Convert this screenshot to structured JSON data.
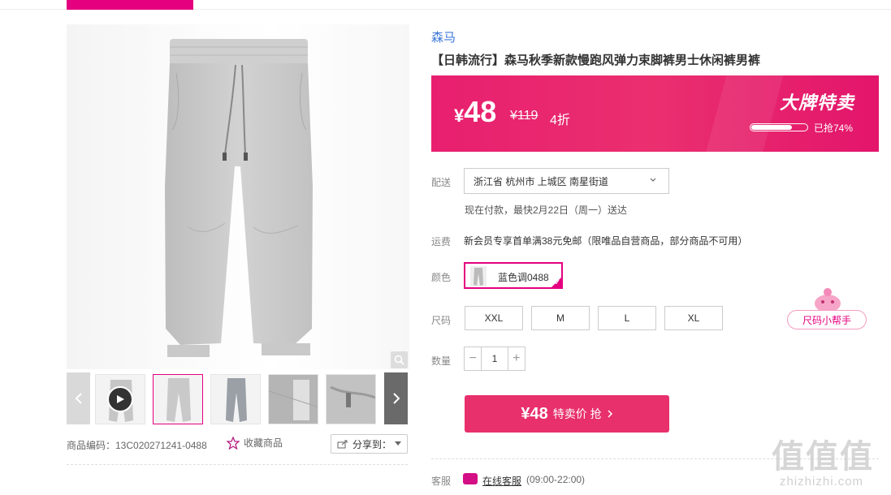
{
  "brand": "森马",
  "title": "【日韩流行】森马秋季新款慢跑风弹力束脚裤男士休闲裤男裤",
  "price": {
    "currency": "¥",
    "current": "48",
    "original": "¥119",
    "discount": "4折",
    "badge": "大牌特卖",
    "sold_text": "已抢74%",
    "sold_fraction": 0.74
  },
  "delivery": {
    "label": "配送",
    "address": "浙江省 杭州市 上城区 南星街道",
    "tip": "现在付款，最快2月22日（周一）送达"
  },
  "shipping": {
    "label": "运费",
    "text": "新会员专享首单满38元免邮（限唯品自营商品，部分商品不可用）"
  },
  "color": {
    "label": "颜色",
    "selected": "蓝色调0488"
  },
  "size": {
    "label": "尺码",
    "options": [
      "XXL",
      "M",
      "L",
      "XL"
    ],
    "helper": "尺码小帮手"
  },
  "quantity": {
    "label": "数量",
    "value": "1",
    "minus": "−",
    "plus": "+"
  },
  "buy": {
    "price": "¥48",
    "text": "特卖价 抢"
  },
  "service": {
    "label": "客服",
    "link": "在线客服",
    "hours": "(09:00-22:00)"
  },
  "product_meta": {
    "code": "商品编码：13C020271241-0488",
    "favorite": "收藏商品",
    "share": "分享到："
  },
  "watermark": {
    "main": "值值值",
    "sub": "zhizhizhi.com"
  },
  "colors": {
    "accent": "#e4007f",
    "price_bg": "#e8306d",
    "brand_link": "#3d78d8"
  }
}
